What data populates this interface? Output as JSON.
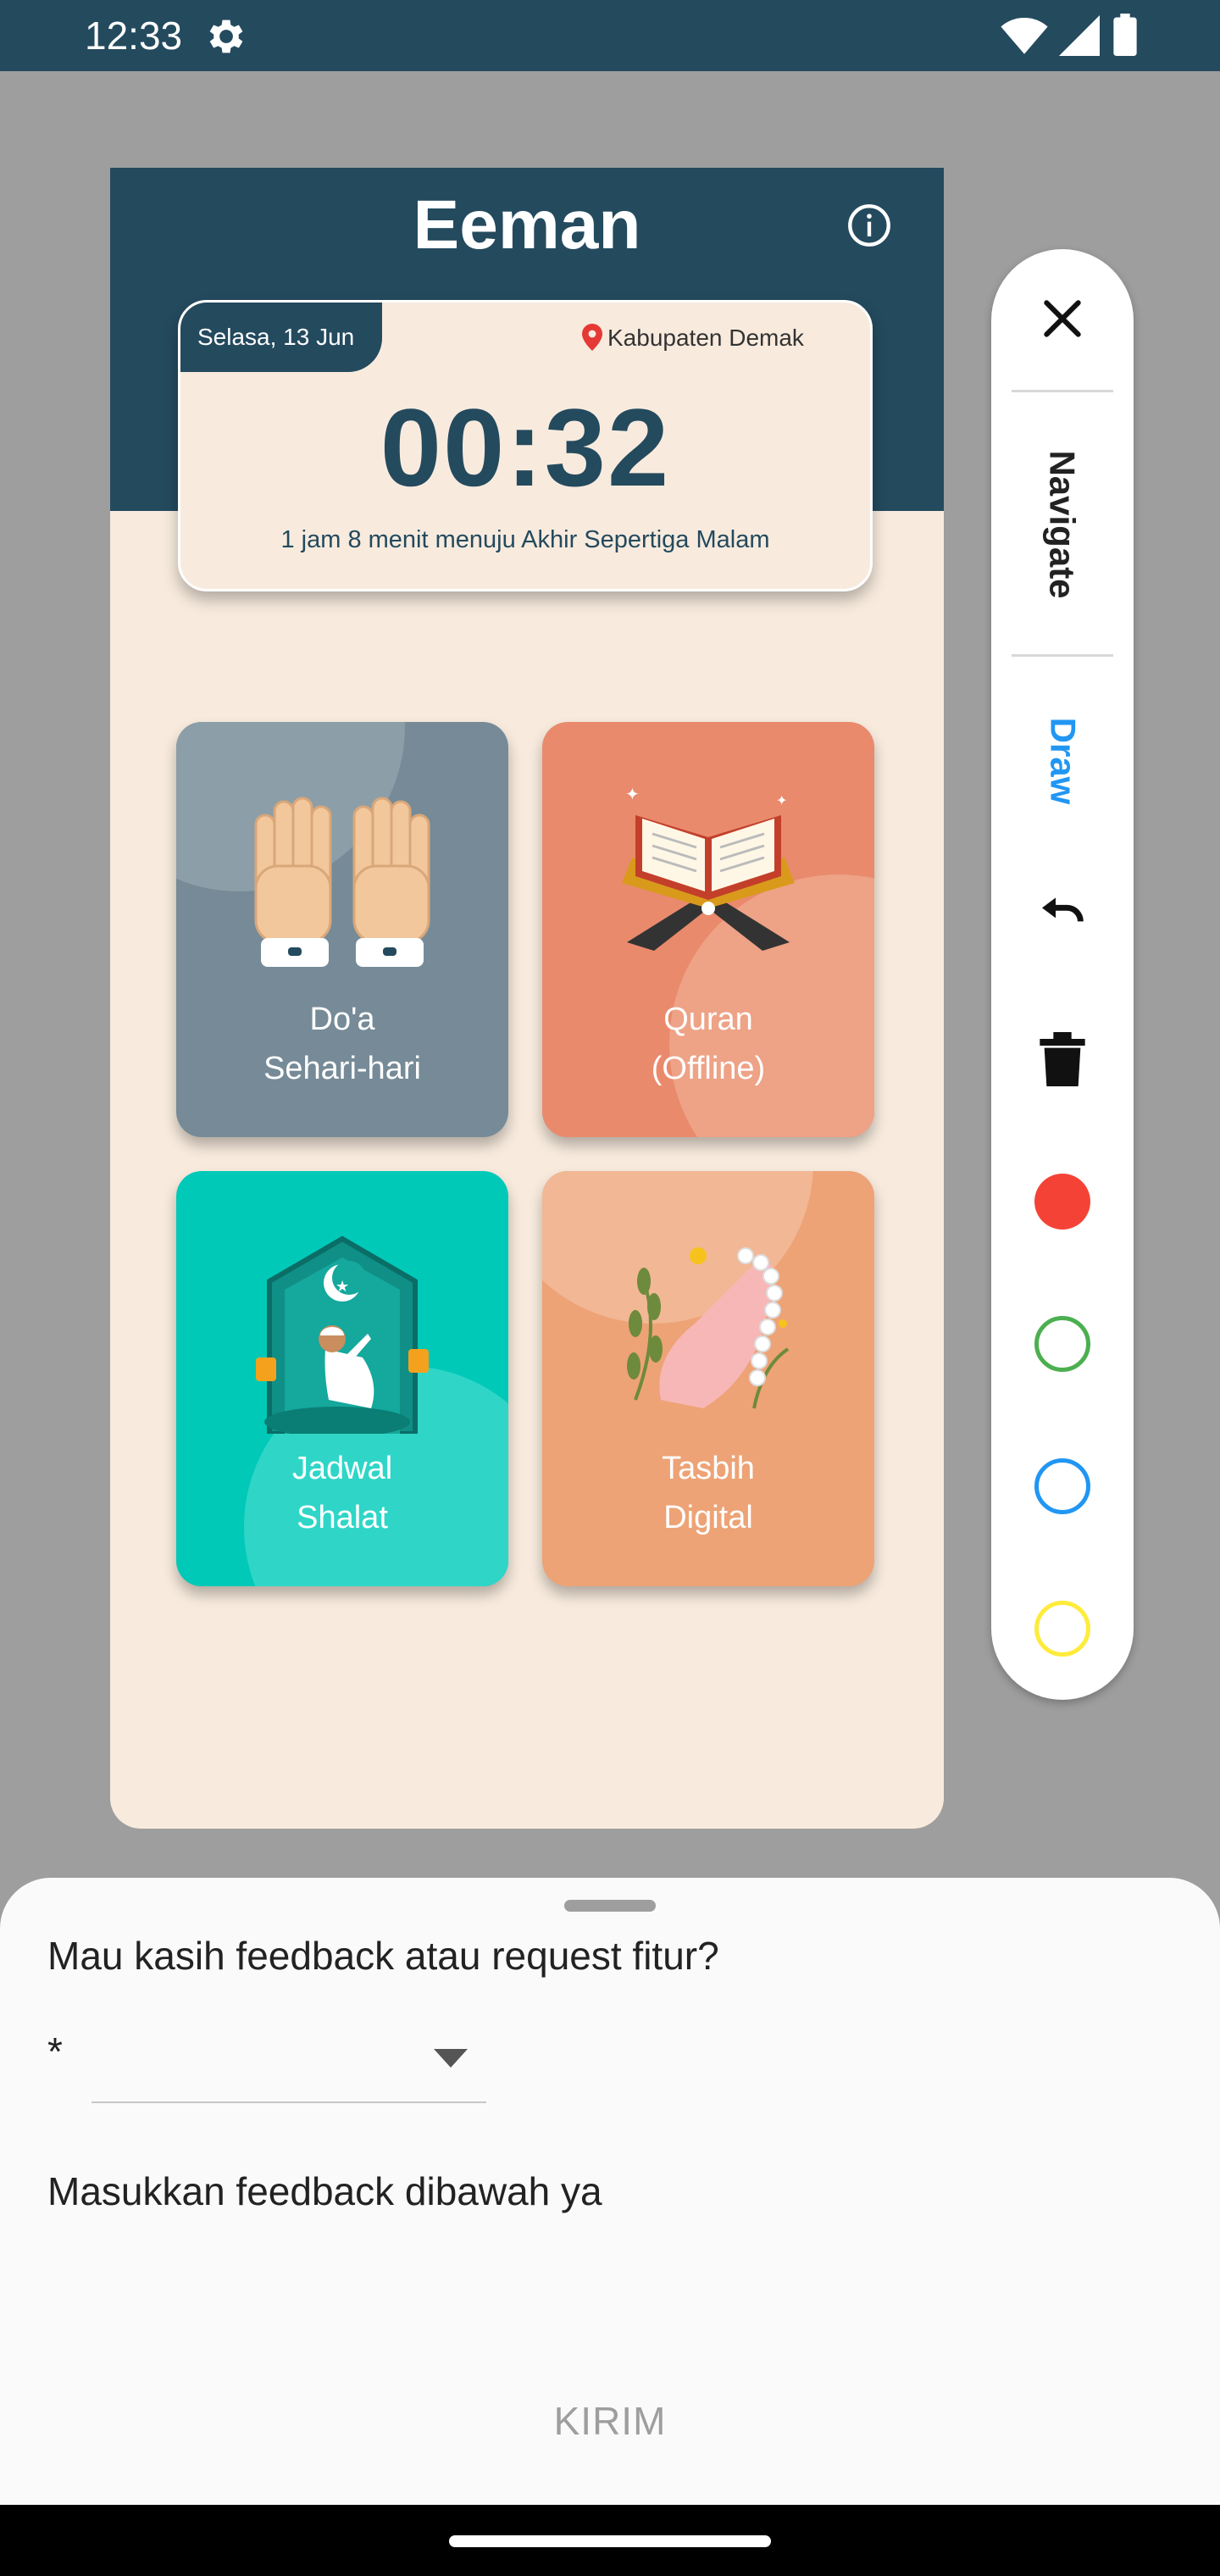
{
  "status_bar": {
    "time": "12:33"
  },
  "app": {
    "title": "Eeman",
    "date": "Selasa, 13 Jun",
    "location": "Kabupaten Demak",
    "time": "00:32",
    "countdown": "1 jam 8 menit menuju Akhir Sepertiga Malam",
    "menu": [
      {
        "line1": "Do'a",
        "line2": "Sehari-hari"
      },
      {
        "line1": "Quran",
        "line2": "(Offline)"
      },
      {
        "line1": "Jadwal",
        "line2": "Shalat"
      },
      {
        "line1": "Tasbih",
        "line2": "Digital"
      }
    ]
  },
  "toolbar": {
    "navigate_label": "Navigate",
    "draw_label": "Draw",
    "colors": {
      "red": "#f44336",
      "green": "#4caf50",
      "blue": "#2196f3",
      "yellow": "#ffeb3b"
    }
  },
  "feedback": {
    "question": "Mau kasih feedback atau request fitur?",
    "required_mark": "*",
    "selected_value": "",
    "message_placeholder": "Masukkan feedback dibawah ya",
    "submit_label": "KIRIM"
  },
  "theme": {
    "primary": "#244a5e",
    "background": "#f8ebde"
  }
}
